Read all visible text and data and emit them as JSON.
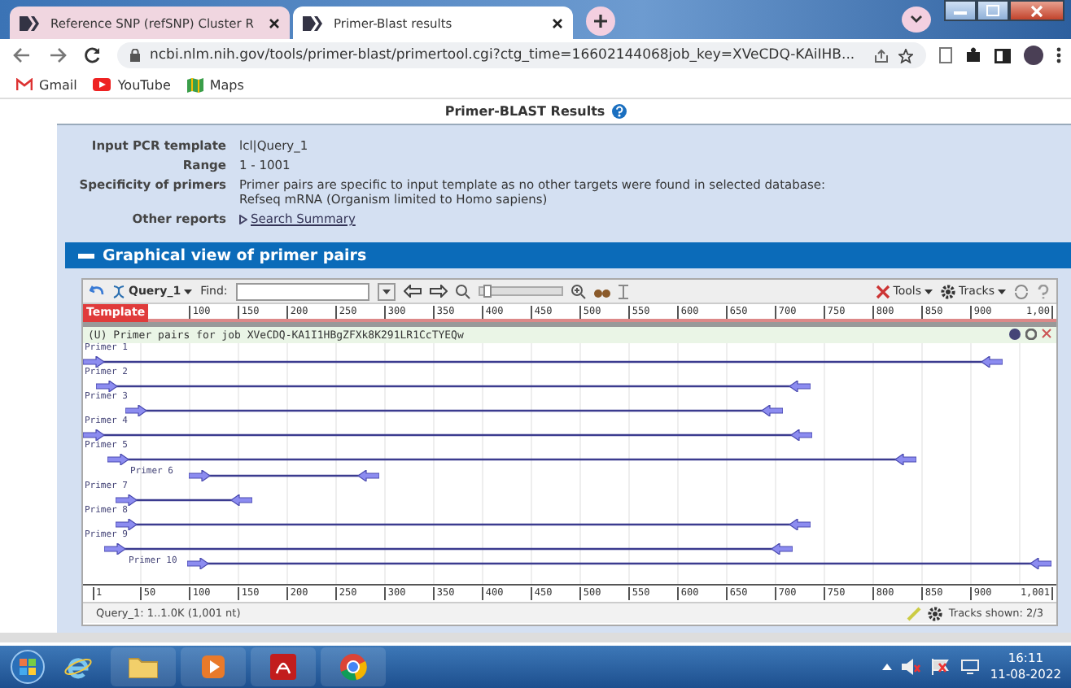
{
  "browser": {
    "tabs": [
      {
        "title": "Reference SNP (refSNP) Cluster R",
        "selected": false
      },
      {
        "title": "Primer-Blast results",
        "selected": true
      }
    ],
    "url": "ncbi.nlm.nih.gov/tools/primer-blast/primertool.cgi?ctg_time=16602144068job_key=XVeCDQ-KAiIHB...",
    "bookmarks": [
      "Gmail",
      "YouTube",
      "Maps"
    ]
  },
  "page": {
    "title": "Primer-BLAST Results",
    "info": [
      {
        "label": "Input PCR template",
        "lines": [
          "lcl|Query_1"
        ]
      },
      {
        "label": "Range",
        "lines": [
          "1 - 1001"
        ]
      },
      {
        "label": "Specificity of primers",
        "lines": [
          "Primer pairs are specific to input template as no other targets were found in selected database:",
          "Refseq mRNA (Organism limited to Homo sapiens)"
        ]
      }
    ],
    "other_reports": {
      "label": "Other reports",
      "link": "Search Summary"
    },
    "section": "Graphical view of primer pairs",
    "viewer": {
      "zoom": {
        "level": 0.05
      },
      "sequence": "Query_1",
      "find_label": "Find:",
      "tools": "Tools",
      "tracks": "Tracks",
      "ruler_label": "Template",
      "top_ticks": [
        "100",
        "150",
        "200",
        "250",
        "300",
        "350",
        "400",
        "450",
        "500",
        "550",
        "600",
        "650",
        "700",
        "750",
        "800",
        "850",
        "900",
        "1,00"
      ],
      "track_title": "(U) Primer pairs for job XVeCDQ-KA1I1HBgZFXk8K291LR1CcTYEQw",
      "primers": [
        {
          "label": "Primer 1"
        },
        {
          "label": "Primer 2"
        },
        {
          "label": "Primer 3"
        },
        {
          "label": "Primer 4"
        },
        {
          "label": "Primer 5"
        },
        {
          "label": "Primer 6"
        },
        {
          "label": "Primer 7"
        },
        {
          "label": "Primer 8"
        },
        {
          "label": "Primer 9"
        },
        {
          "label": "Primer 10"
        }
      ],
      "bottom_ticks": [
        "1",
        "50",
        "100",
        "150",
        "200",
        "250",
        "300",
        "350",
        "400",
        "450",
        "500",
        "550",
        "600",
        "650",
        "700",
        "750",
        "800",
        "850",
        "900",
        "1,001"
      ],
      "status": "Query_1: 1..1.0K (1,001 nt)",
      "tracks_shown": "Tracks shown: 2/3"
    }
  },
  "taskbar": {
    "time": "16:11",
    "date": "11-08-2022"
  }
}
